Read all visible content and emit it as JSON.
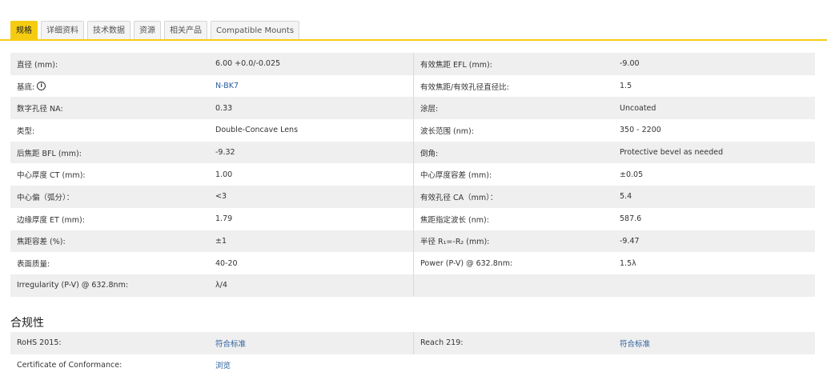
{
  "tabs": [
    {
      "label": "规格",
      "active": true
    },
    {
      "label": "详细资料",
      "active": false
    },
    {
      "label": "技术数据",
      "active": false
    },
    {
      "label": "资源",
      "active": false
    },
    {
      "label": "相关产品",
      "active": false
    },
    {
      "label": "Compatible Mounts",
      "active": false
    }
  ],
  "specs": {
    "rows": [
      {
        "l1": "直径 (mm):",
        "v1": "6.00 +0.0/-0.025",
        "l2": "有效焦距 EFL (mm):",
        "v2": "-9.00"
      },
      {
        "l1": "基底:",
        "v1": "N-BK7",
        "l2": "有效焦距/有效孔径直径比:",
        "v2": "1.5"
      },
      {
        "l1": "数字孔径 NA:",
        "v1": "0.33",
        "l2": "涂层:",
        "v2": "Uncoated"
      },
      {
        "l1": "类型:",
        "v1": "Double-Concave Lens",
        "l2": "波长范围 (nm):",
        "v2": "350 - 2200"
      },
      {
        "l1": "后焦距 BFL (mm):",
        "v1": "-9.32",
        "l2": "倒角:",
        "v2": "Protective bevel as needed"
      },
      {
        "l1": "中心厚度 CT (mm):",
        "v1": "1.00",
        "l2": "中心厚度容差 (mm):",
        "v2": "±0.05"
      },
      {
        "l1": "中心偏（弧分）：",
        "v1": "<3",
        "l2": "有效孔径 CA（mm）：",
        "v2": "5.4"
      },
      {
        "l1": "边缘厚度 ET (mm):",
        "v1": "1.79",
        "l2": "焦距指定波长 (nm):",
        "v2": "587.6"
      },
      {
        "l1": "焦距容差 (%):",
        "v1": "±1",
        "l2": "半径 R₁=-R₂ (mm):",
        "v2": "-9.47"
      },
      {
        "l1": "表面质量:",
        "v1": "40-20",
        "l2": "Power (P-V) @ 632.8nm:",
        "v2": "1.5λ"
      },
      {
        "l1": "Irregularity (P-V) @ 632.8nm:",
        "v1": "λ/4",
        "l2": "",
        "v2": ""
      }
    ],
    "info_icon_char": "i"
  },
  "compliance": {
    "title": "合规性",
    "rows": [
      {
        "l1": "RoHS 2015:",
        "v1": "符合标准",
        "l2": "Reach 219:",
        "v2": "符合标准"
      },
      {
        "l1": "Certificate of Conformance:",
        "v1": "浏览",
        "l2": "",
        "v2": ""
      }
    ]
  },
  "colors": {
    "accent": "#f5cc12",
    "link": "#2a5f9e",
    "row_shade": "#efefef"
  }
}
